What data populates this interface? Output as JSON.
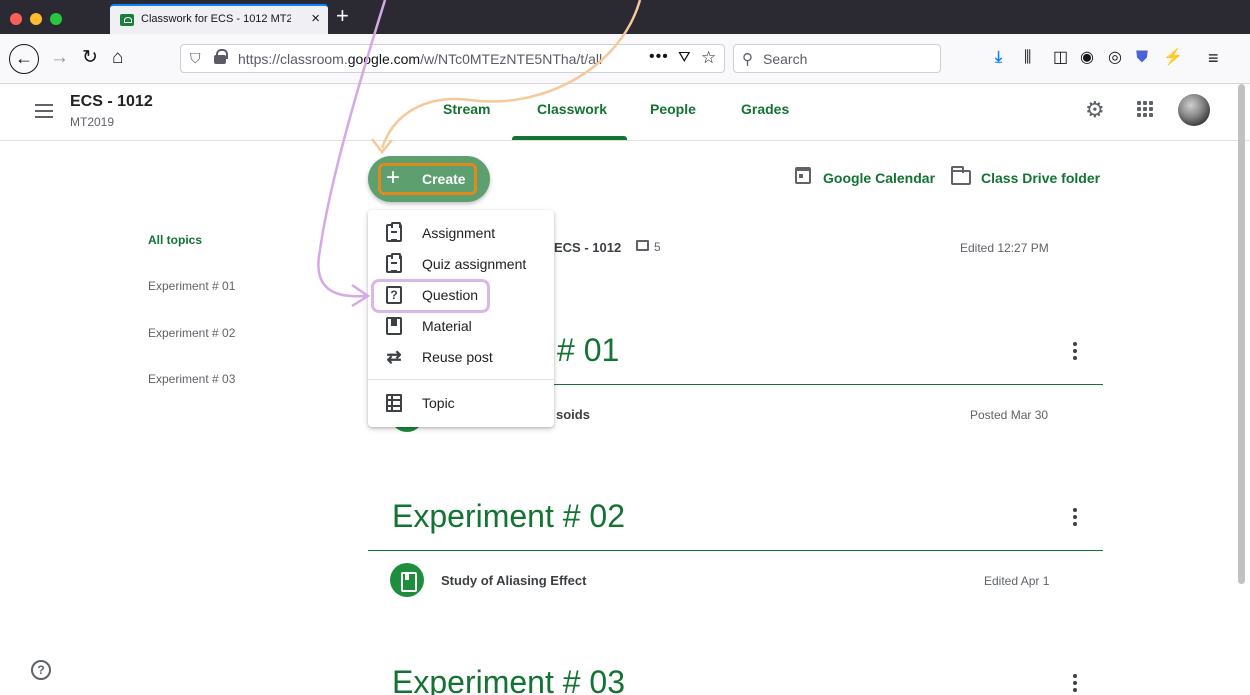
{
  "browser": {
    "tab_title": "Classwork for ECS - 1012 MT2019",
    "new_tab_label": "+",
    "url_prefix": "https://classroom.",
    "url_domain": "google.com",
    "url_path": "/w/NTc0MTEzNTE5NTha/t/all",
    "search_placeholder": "Search"
  },
  "header": {
    "class_name": "ECS - 1012",
    "class_section": "MT2019",
    "tabs": [
      {
        "label": "Stream"
      },
      {
        "label": "Classwork",
        "active": true
      },
      {
        "label": "People"
      },
      {
        "label": "Grades"
      }
    ]
  },
  "toolbar": {
    "create_label": "Create",
    "calendar_label": "Google Calendar",
    "drive_label": "Class Drive folder"
  },
  "topics_nav": [
    {
      "label": "All topics",
      "active": true
    },
    {
      "label": "Experiment # 01"
    },
    {
      "label": "Experiment # 02"
    },
    {
      "label": "Experiment # 03"
    }
  ],
  "create_menu": {
    "items": [
      {
        "label": "Assignment",
        "icon": "assignment-icon"
      },
      {
        "label": "Quiz assignment",
        "icon": "quiz-assignment-icon"
      },
      {
        "label": "Question",
        "icon": "question-icon",
        "highlighted": true
      },
      {
        "label": "Material",
        "icon": "material-icon"
      },
      {
        "label": "Reuse post",
        "icon": "reuse-icon"
      },
      {
        "label": "Topic",
        "icon": "topic-icon"
      }
    ]
  },
  "posts": {
    "top_post": {
      "title_fragment": "ECS - 1012",
      "comment_count": "5",
      "meta": "Edited 12:27 PM"
    },
    "section1": {
      "title_fragment": "# 01",
      "post_fragment": "soids",
      "post_meta": "Posted Mar 30"
    },
    "section2": {
      "title": "Experiment # 02",
      "post_title": "Study of Aliasing Effect",
      "post_meta": "Edited Apr 1"
    },
    "section3": {
      "title": "Experiment # 03"
    }
  },
  "colors": {
    "accent_green": "#137333",
    "create_button": "#5e9f6f",
    "create_highlight": "#e08a1e",
    "question_highlight": "#d8b6e8"
  }
}
